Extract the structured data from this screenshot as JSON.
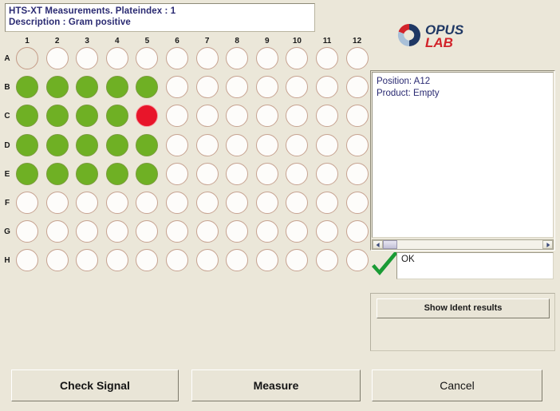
{
  "header": {
    "line1": "HTS-XT Measurements. Plateindex : 1",
    "line2": "Description : Gram positive"
  },
  "logo": {
    "name_top": "OPUS",
    "name_bottom": "LAB",
    "colors": {
      "navy": "#1f3864",
      "red": "#d2232a",
      "light_blue": "#a9c0d8"
    }
  },
  "plate": {
    "column_headers": [
      "1",
      "2",
      "3",
      "4",
      "5",
      "6",
      "7",
      "8",
      "9",
      "10",
      "11",
      "12"
    ],
    "row_headers": [
      "A",
      "B",
      "C",
      "D",
      "E",
      "F",
      "G",
      "H"
    ],
    "well_states": [
      [
        "unfilled",
        "empty",
        "empty",
        "empty",
        "empty",
        "empty",
        "empty",
        "empty",
        "empty",
        "empty",
        "empty",
        "empty"
      ],
      [
        "green",
        "green",
        "green",
        "green",
        "green",
        "empty",
        "empty",
        "empty",
        "empty",
        "empty",
        "empty",
        "empty"
      ],
      [
        "green",
        "green",
        "green",
        "green",
        "red",
        "empty",
        "empty",
        "empty",
        "empty",
        "empty",
        "empty",
        "empty"
      ],
      [
        "green",
        "green",
        "green",
        "green",
        "green",
        "empty",
        "empty",
        "empty",
        "empty",
        "empty",
        "empty",
        "empty"
      ],
      [
        "green",
        "green",
        "green",
        "green",
        "green",
        "empty",
        "empty",
        "empty",
        "empty",
        "empty",
        "empty",
        "empty"
      ],
      [
        "empty",
        "empty",
        "empty",
        "empty",
        "empty",
        "empty",
        "empty",
        "empty",
        "empty",
        "empty",
        "empty",
        "empty"
      ],
      [
        "empty",
        "empty",
        "empty",
        "empty",
        "empty",
        "empty",
        "empty",
        "empty",
        "empty",
        "empty",
        "empty",
        "empty"
      ],
      [
        "empty",
        "empty",
        "empty",
        "empty",
        "empty",
        "empty",
        "empty",
        "empty",
        "empty",
        "empty",
        "empty",
        "empty"
      ]
    ],
    "state_colors": {
      "green": "#6fb024",
      "red": "#e8152a",
      "empty": "#fdfcfa",
      "ring": "#c7a391"
    }
  },
  "position_panel": {
    "line1": "Position: A12",
    "line2": "Product: Empty",
    "scrollbar": {
      "left_arrow_icon": "scroll-left-arrow-icon",
      "right_arrow_icon": "scroll-right-arrow-icon"
    }
  },
  "status": {
    "check_icon": "green-checkmark-icon",
    "message": "OK"
  },
  "ident_group": {
    "button_label": "Show Ident results"
  },
  "actions": {
    "check_signal": "Check Signal",
    "measure": "Measure",
    "cancel": "Cancel"
  }
}
